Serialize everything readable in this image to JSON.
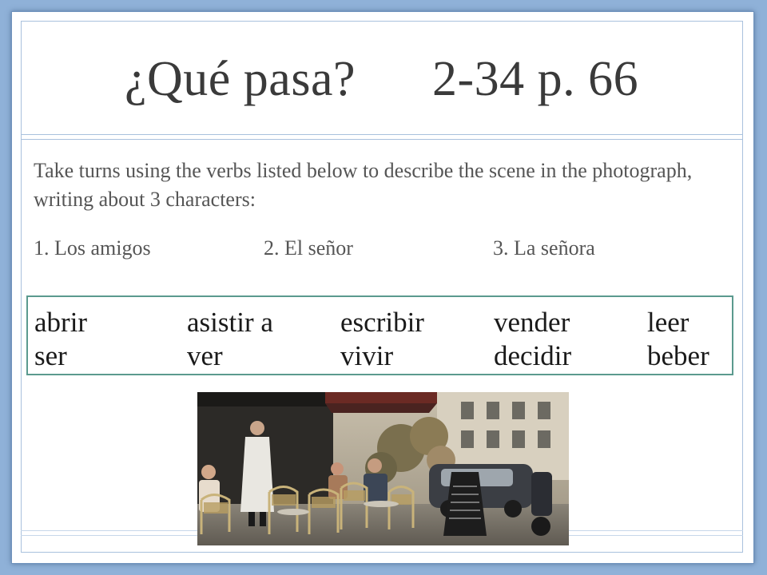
{
  "slide": {
    "title": "¿Qué pasa?      2-34 p. 66",
    "instructions": "Take turns using the verbs listed below to describe the scene in the photograph, writing about 3 characters:",
    "characters": [
      "1. Los amigos",
      "2. El señor",
      "3. La señora"
    ],
    "verbs": {
      "row1": [
        "abrir",
        "asistir a",
        "escribir",
        "vender",
        "leer"
      ],
      "row2": [
        "ser",
        "ver",
        "vivir",
        "decidir",
        "beber"
      ]
    }
  },
  "colors": {
    "background": "#8fb1d8",
    "title_text": "#3a3a3a",
    "body_text": "#555555",
    "verb_box_border": "#5b9a8e"
  }
}
